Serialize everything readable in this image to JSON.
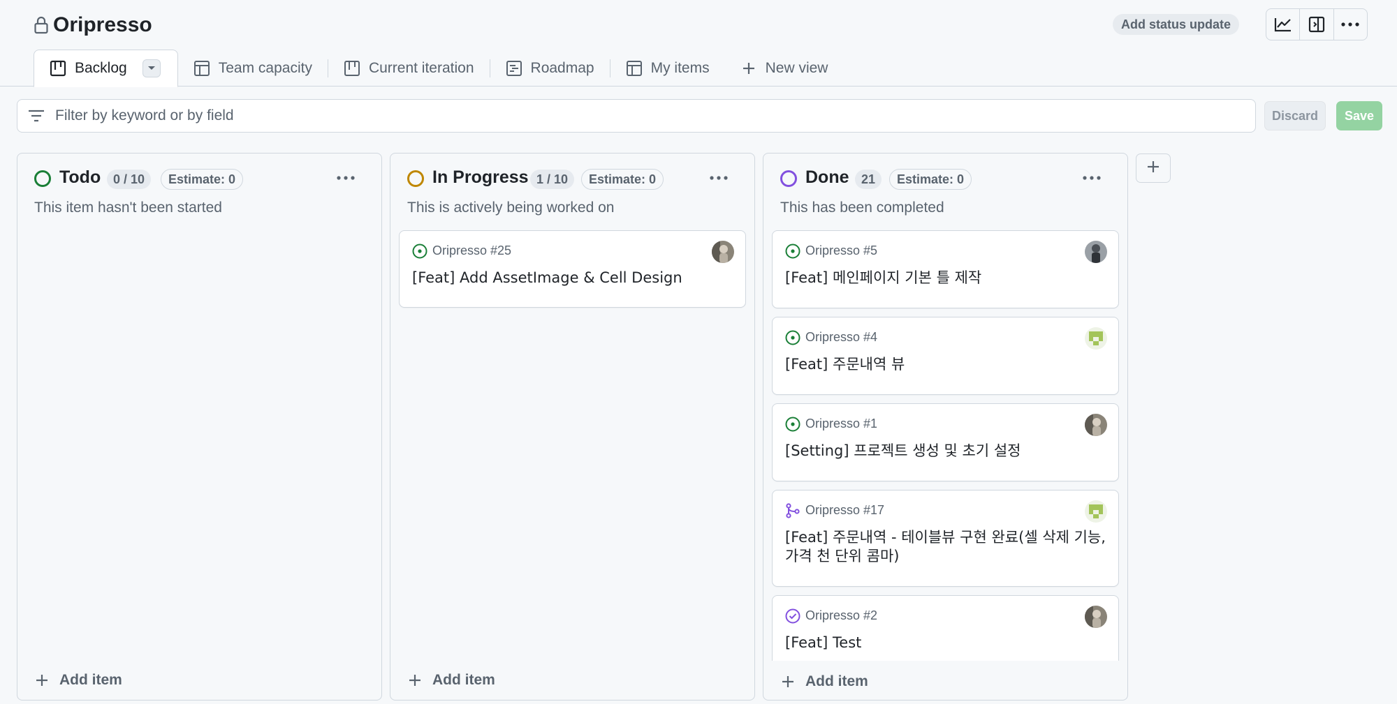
{
  "project": {
    "title": "Oripresso",
    "lock_icon": "lock-icon",
    "status_update_label": "Add status update"
  },
  "header_icons": [
    "insights-graph-icon",
    "sidebar-panel-icon",
    "kebab-menu-icon"
  ],
  "tabs": [
    {
      "label": "Backlog",
      "icon": "board-icon",
      "active": true
    },
    {
      "label": "Team capacity",
      "icon": "table-icon"
    },
    {
      "label": "Current iteration",
      "icon": "board-icon"
    },
    {
      "label": "Roadmap",
      "icon": "roadmap-icon"
    },
    {
      "label": "My items",
      "icon": "table-icon"
    },
    {
      "label": "New view",
      "icon": "plus-icon"
    }
  ],
  "filter": {
    "placeholder": "Filter by keyword or by field",
    "value": "",
    "discard_label": "Discard",
    "save_label": "Save"
  },
  "colors": {
    "todo": "#1a7f37",
    "in_progress": "#bf8700",
    "done": "#8250df",
    "save_disabled": "#94d3a2",
    "open_issue": "#1a7f37",
    "merged": "#8250df"
  },
  "columns": [
    {
      "name": "Todo",
      "count": "0 / 10",
      "estimate": "Estimate: 0",
      "description": "This item hasn't been started",
      "status_color": "#1a7f37",
      "add_item_label": "Add item",
      "cards": []
    },
    {
      "name": "In Progress",
      "count": "1 / 10",
      "estimate": "Estimate: 0",
      "description": "This is actively being worked on",
      "status_color": "#bf8700",
      "add_item_label": "Add item",
      "cards": [
        {
          "ref": "Oripresso #25",
          "title": "[Feat] Add AssetImage & Cell Design",
          "type": "open-issue",
          "avatar": "photo"
        }
      ]
    },
    {
      "name": "Done",
      "count": "21",
      "estimate": "Estimate: 0",
      "description": "This has been completed",
      "status_color": "#8250df",
      "add_item_label": "Add item",
      "cards": [
        {
          "ref": "Oripresso #5",
          "title": "[Feat] 메인페이지 기본 틀 제작",
          "type": "open-issue",
          "avatar": "photo-2"
        },
        {
          "ref": "Oripresso #4",
          "title": "[Feat] 주문내역 뷰",
          "type": "open-issue",
          "avatar": "identicon"
        },
        {
          "ref": "Oripresso #1",
          "title": "[Setting] 프로젝트 생성 및 초기 설정",
          "type": "open-issue",
          "avatar": "photo"
        },
        {
          "ref": "Oripresso #17",
          "title": "[Feat] 주문내역 - 테이블뷰 구현 완료(셀 삭제 기능, 가격 천 단위 콤마)",
          "type": "merged-pr",
          "avatar": "identicon"
        },
        {
          "ref": "Oripresso #2",
          "title": "[Feat] Test",
          "type": "closed-issue",
          "avatar": "photo"
        }
      ]
    }
  ]
}
